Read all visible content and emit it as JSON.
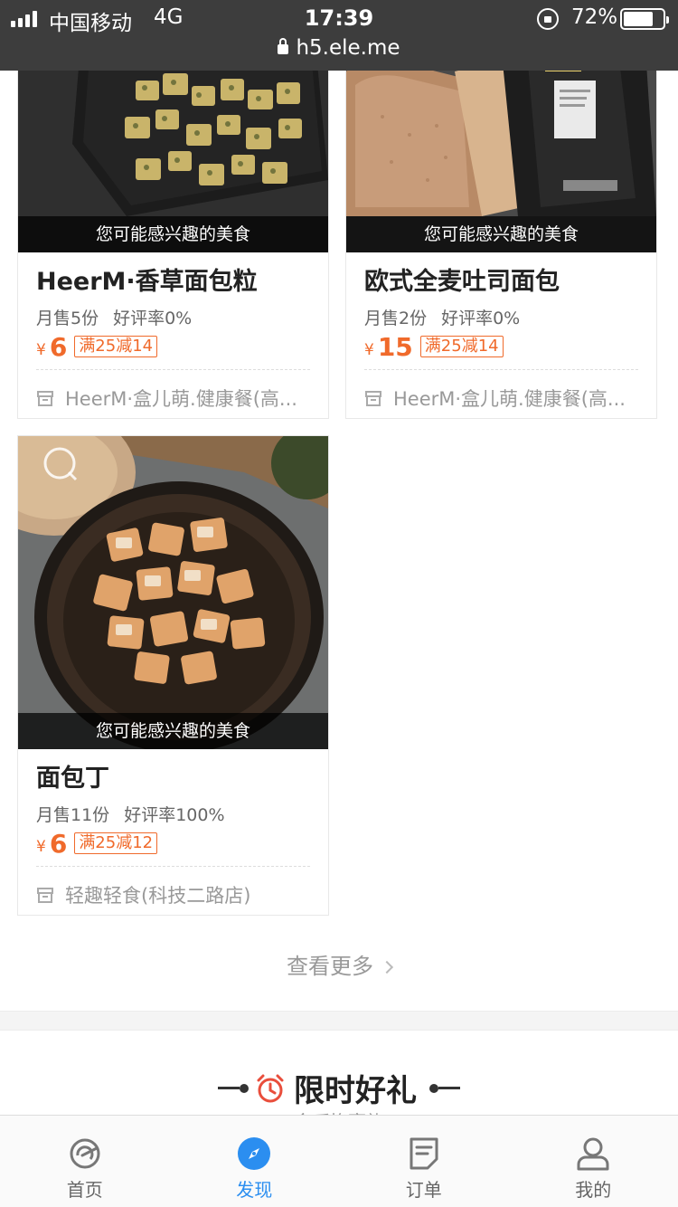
{
  "status_bar": {
    "carrier": "中国移动",
    "network": "4G",
    "time": "17:39",
    "battery": "72%",
    "url": "h5.ele.me"
  },
  "cards": [
    {
      "banner": "您可能感兴趣的美食",
      "name": "HeerM·香草面包粒",
      "monthly_sales": "月售5份",
      "rating": "好评率0%",
      "currency": "¥",
      "price": "6",
      "promo": "满25减14",
      "shop": "HeerM·盒儿萌.健康餐(高..."
    },
    {
      "banner": "您可能感兴趣的美食",
      "name": "欧式全麦吐司面包",
      "monthly_sales": "月售2份",
      "rating": "好评率0%",
      "currency": "¥",
      "price": "15",
      "promo": "满25减14",
      "shop": "HeerM·盒儿萌.健康餐(高..."
    },
    {
      "banner": "您可能感兴趣的美食",
      "name": "面包丁",
      "monthly_sales": "月售11份",
      "rating": "好评率100%",
      "currency": "¥",
      "price": "6",
      "promo": "满25减12",
      "shop": "轻趣轻食(科技二路店)"
    }
  ],
  "see_more": "查看更多",
  "gift_section": {
    "title": "限时好礼",
    "subtitle": "金币换豪礼"
  },
  "tabbar": {
    "items": [
      {
        "label": "首页",
        "icon": "home-icon"
      },
      {
        "label": "发现",
        "icon": "discover-compass-icon"
      },
      {
        "label": "订单",
        "icon": "orders-icon"
      },
      {
        "label": "我的",
        "icon": "profile-icon"
      }
    ],
    "active": "发现"
  },
  "colors": {
    "accent_price": "#f06a2b",
    "active_tab": "#2b8ef0",
    "alarm_icon": "#e94e3c"
  }
}
